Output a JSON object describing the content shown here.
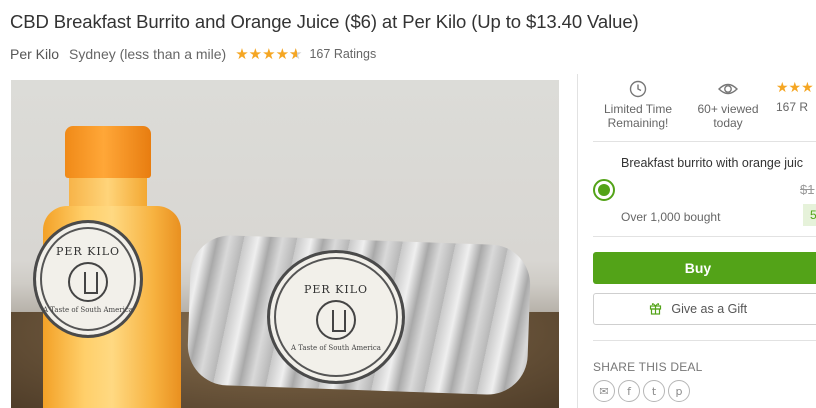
{
  "deal": {
    "title": "CBD Breakfast Burrito and Orange Juice ($6) at Per Kilo (Up to $13.40 Value)",
    "merchant": "Per Kilo",
    "location": "Sydney (less than a mile)",
    "rating": 4.5,
    "ratings_text": "167 Ratings"
  },
  "photo": {
    "logo_text": "PER KILO",
    "logo_sub": "A Taste of South America"
  },
  "stats": {
    "time_label": "Limited Time Remaining!",
    "viewed_line1": "60+ viewed",
    "viewed_line2": "today",
    "ratings_short": "167 R"
  },
  "option": {
    "title": "Breakfast burrito with orange juic",
    "original_price": "$1",
    "bought": "Over 1,000 bought",
    "discount": "5",
    "selected": true
  },
  "actions": {
    "buy_label": "Buy",
    "gift_label": "Give as a Gift"
  },
  "share": {
    "label": "SHARE THIS DEAL",
    "icons": [
      "email-icon",
      "facebook-icon",
      "twitter-icon",
      "pinterest-icon"
    ],
    "glyphs": [
      "✉",
      "f",
      "t",
      "p"
    ]
  },
  "colors": {
    "accent": "#53a318",
    "star": "#f5a623"
  }
}
